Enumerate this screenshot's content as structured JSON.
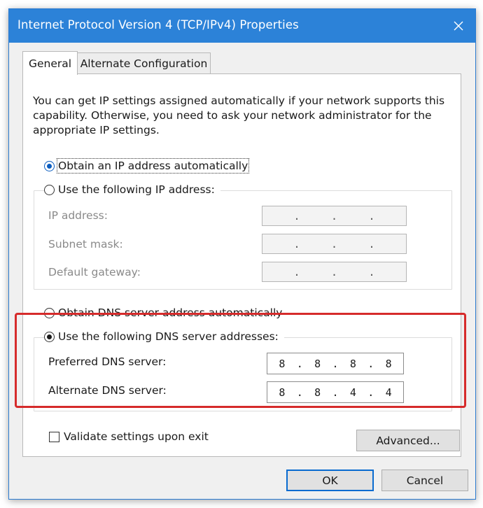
{
  "window": {
    "title": "Internet Protocol Version 4 (TCP/IPv4) Properties"
  },
  "tabs": [
    {
      "label": "General",
      "active": true
    },
    {
      "label": "Alternate Configuration",
      "active": false
    }
  ],
  "description": "You can get IP settings assigned automatically if your network supports this capability. Otherwise, you need to ask your network administrator for the appropriate IP settings.",
  "ip_section": {
    "auto_option": {
      "label": "Obtain an IP address automatically",
      "selected": true
    },
    "manual_option": {
      "label": "Use the following IP address:",
      "selected": false
    },
    "fields": [
      {
        "label": "IP address:",
        "value": ". . .",
        "enabled": false
      },
      {
        "label": "Subnet mask:",
        "value": ". . .",
        "enabled": false
      },
      {
        "label": "Default gateway:",
        "value": ". . .",
        "enabled": false
      }
    ]
  },
  "dns_section": {
    "auto_option": {
      "label": "Obtain DNS server address automatically",
      "selected": false
    },
    "manual_option": {
      "label": "Use the following DNS server addresses:",
      "selected": true
    },
    "preferred": {
      "label": "Preferred DNS server:",
      "octets": [
        "8",
        "8",
        "8",
        "8"
      ]
    },
    "alternate": {
      "label": "Alternate DNS server:",
      "octets": [
        "8",
        "8",
        "4",
        "4"
      ]
    }
  },
  "validate_checkbox": {
    "label": "Validate settings upon exit",
    "checked": false
  },
  "buttons": {
    "advanced": "Advanced...",
    "ok": "OK",
    "cancel": "Cancel"
  },
  "colors": {
    "titlebar": "#2c82d8",
    "highlight": "#d62b2b",
    "selected_radio": "#0a5cbf"
  },
  "icons": {
    "close": "close-icon"
  }
}
